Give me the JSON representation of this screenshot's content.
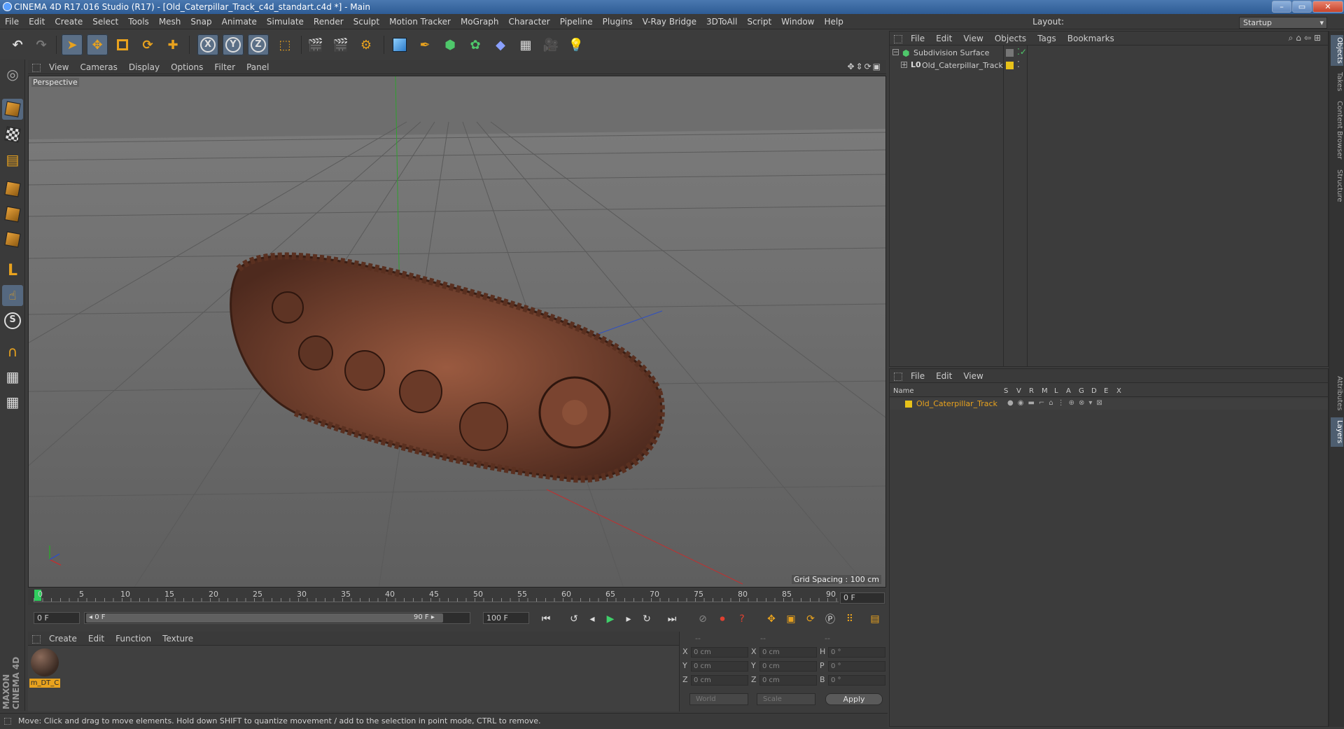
{
  "window": {
    "title": "CINEMA 4D R17.016 Studio (R17) - [Old_Caterpillar_Track_c4d_standart.c4d *] - Main",
    "buttons": {
      "minimize": "–",
      "maximize": "▭",
      "close": "✕"
    }
  },
  "menubar": {
    "items": [
      "File",
      "Edit",
      "Create",
      "Select",
      "Tools",
      "Mesh",
      "Snap",
      "Animate",
      "Simulate",
      "Render",
      "Sculpt",
      "Motion Tracker",
      "MoGraph",
      "Character",
      "Pipeline",
      "Plugins",
      "V-Ray Bridge",
      "3DToAll",
      "Script",
      "Window",
      "Help"
    ],
    "layout_label": "Layout:",
    "layout_value": "Startup"
  },
  "viewport": {
    "menu": [
      "View",
      "Cameras",
      "Display",
      "Options",
      "Filter",
      "Panel"
    ],
    "label": "Perspective",
    "grid_spacing": "Grid Spacing : 100 cm"
  },
  "timeline": {
    "ticks": [
      "0",
      "5",
      "10",
      "15",
      "20",
      "25",
      "30",
      "35",
      "40",
      "45",
      "50",
      "55",
      "60",
      "65",
      "70",
      "75",
      "80",
      "85",
      "90"
    ],
    "current_frame": "0 F",
    "start_field": "0 F",
    "range_start": "◂ 0 F",
    "range_end": "90 F ▸",
    "end_field": "100 F"
  },
  "material_panel": {
    "menu": [
      "Create",
      "Edit",
      "Function",
      "Texture"
    ],
    "materials": [
      {
        "name": "m_DT_C"
      }
    ]
  },
  "coordinates": {
    "headers": [
      "--",
      "--",
      "--"
    ],
    "rows": [
      {
        "a": "X",
        "a_val": "0 cm",
        "b": "X",
        "b_val": "0 cm",
        "c": "H",
        "c_val": "0 °"
      },
      {
        "a": "Y",
        "a_val": "0 cm",
        "b": "Y",
        "b_val": "0 cm",
        "c": "P",
        "c_val": "0 °"
      },
      {
        "a": "Z",
        "a_val": "0 cm",
        "b": "Z",
        "b_val": "0 cm",
        "c": "B",
        "c_val": "0 °"
      }
    ],
    "world": "World",
    "scale": "Scale",
    "apply": "Apply"
  },
  "status": {
    "text": "Move: Click and drag to move elements. Hold down SHIFT to quantize movement / add to the selection in point mode, CTRL to remove."
  },
  "object_manager": {
    "menu": [
      "File",
      "Edit",
      "View",
      "Objects",
      "Tags",
      "Bookmarks"
    ],
    "objects": [
      {
        "name": "Subdivision Surface"
      },
      {
        "name": "Old_Caterpillar_Track"
      }
    ]
  },
  "layer_manager": {
    "menu": [
      "File",
      "Edit",
      "View"
    ],
    "columns": [
      "Name",
      "S",
      "V",
      "R",
      "M",
      "L",
      "A",
      "G",
      "D",
      "E",
      "X"
    ],
    "layers": [
      {
        "name": "Old_Caterpillar_Track",
        "color": "#e8c21a"
      }
    ]
  },
  "right_tabs": [
    "Objects",
    "Takes",
    "Content Browser",
    "Structure",
    "Attributes",
    "Layers"
  ],
  "branding": "MAXON CINEMA 4D",
  "colors": {
    "accent_orange": "#e8a21e",
    "selection_blue": "#5b6f86",
    "axis_x": "#c03030",
    "axis_y": "#30a030",
    "axis_z": "#3050c0"
  }
}
